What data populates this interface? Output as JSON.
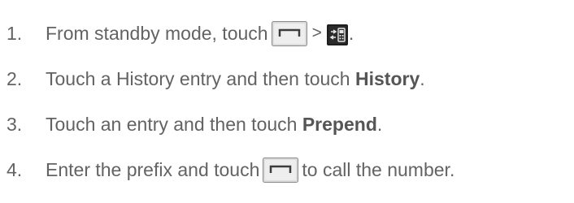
{
  "steps": [
    {
      "number": "1.",
      "text_before": "From standby mode, touch",
      "separator": ">",
      "text_after": ".",
      "icons": [
        "send-key-icon",
        "menu-icon"
      ]
    },
    {
      "number": "2.",
      "text_before": "Touch a History entry and then touch ",
      "bold": "History",
      "text_after": "."
    },
    {
      "number": "3.",
      "text_before": "Touch an entry and then touch ",
      "bold": "Prepend",
      "text_after": "."
    },
    {
      "number": "4.",
      "text_before": "Enter the prefix and touch",
      "text_after": "to call the number.",
      "icons": [
        "send-key-icon"
      ]
    }
  ],
  "colors": {
    "text": "#636363",
    "key_background": "#dcdcdc",
    "key_border": "#555555",
    "menu_background": "#1e1e1e"
  }
}
